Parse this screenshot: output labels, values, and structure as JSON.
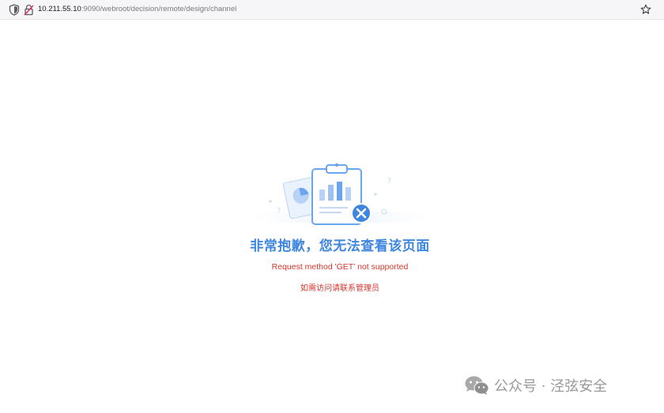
{
  "browser": {
    "url_host": "10.211.55.10",
    "url_path": ":9090/webroot/decision/remote/design/channel"
  },
  "error": {
    "title": "非常抱歉，您无法查看该页面",
    "message": "Request method 'GET' not supported",
    "contact": "如需访问请联系管理员"
  },
  "watermark": {
    "text": "公众号 · 泾弦安全"
  },
  "colors": {
    "title": "#3f86e0",
    "error_text": "#d9362b",
    "watermark": "#9a9a9a",
    "illustration_blue": "#6aa5f0"
  },
  "icons": [
    "shield-icon",
    "lock-icon",
    "bookmark-star-icon",
    "clipboard-chart-illustration",
    "error-x-icon",
    "wechat-icon"
  ]
}
